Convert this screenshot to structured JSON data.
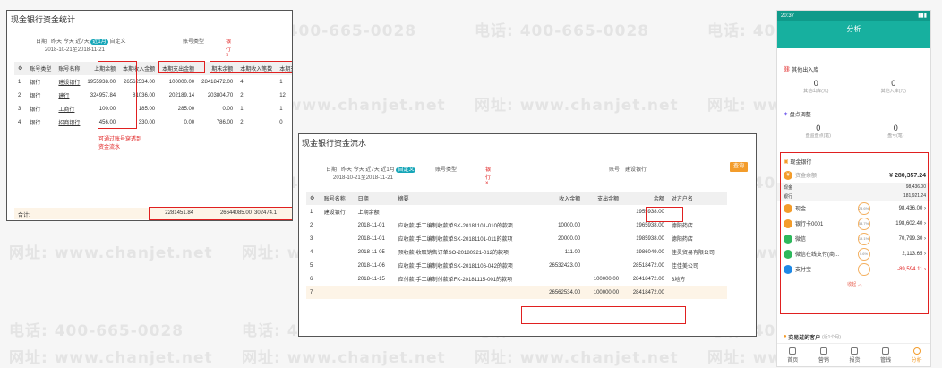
{
  "watermarks": [
    "电话: 400-665-0028",
    "网址: www.chanjet.net"
  ],
  "p1": {
    "title": "现金银行资金统计",
    "date_label": "日期",
    "ranges": [
      "昨天",
      "今天",
      "近7天"
    ],
    "active_range": "近1月",
    "custom": "自定义",
    "date_range": "2018-10-21至2018-11-21",
    "acct_type_label": "账号类型",
    "acct_tag": "银行",
    "acct_label": "账号",
    "headers": [
      "账号类型",
      "账号名称",
      "上期余额",
      "本期收入金额",
      "本期支出金额",
      "期末余额",
      "本期收入笔数",
      "本期支出笔数"
    ],
    "rows": [
      [
        "1",
        "银行",
        "建设银行",
        "1955938.00",
        "26562534.00",
        "100000.00",
        "28418472.00",
        "4",
        "1"
      ],
      [
        "2",
        "银行",
        "建行",
        "324957.84",
        "81036.00",
        "202189.14",
        "203804.70",
        "2",
        "12"
      ],
      [
        "3",
        "银行",
        "工商行",
        "100.00",
        "185.00",
        "285.00",
        "0.00",
        "1",
        "1"
      ],
      [
        "4",
        "银行",
        "招商银行",
        "456.00",
        "330.00",
        "0.00",
        "786.00",
        "2",
        "0"
      ]
    ],
    "note": "可通过账号穿透到资金流水",
    "total_label": "合计:",
    "totals": [
      "2281451.84",
      "26644085.00",
      "302474.1"
    ]
  },
  "p2": {
    "title": "现金银行资金流水",
    "date_label": "日期",
    "ranges": [
      "昨天",
      "今天",
      "近7天",
      "近1月"
    ],
    "active_range": "自定义",
    "date_range": "2018-10-21至2018-11-21",
    "acct_type_label": "账号类型",
    "acct_tag": "银行",
    "acct_label": "账号",
    "acct_value": "建设银行",
    "query": "查询",
    "headers": [
      "账号名称",
      "日期",
      "摘要",
      "收入金额",
      "支出金额",
      "余额",
      "对方户名"
    ],
    "rows": [
      [
        "1",
        "建设银行",
        "上期余额",
        "",
        "",
        "",
        "1955938.00",
        ""
      ],
      [
        "2",
        "",
        "2018-11-01",
        "应收款-手工编制收款单SK-20181101-010的款项",
        "10000.00",
        "",
        "1965938.00",
        "德阳药店"
      ],
      [
        "3",
        "",
        "2018-11-01",
        "应收款-手工编制收款单SK-20181101-011的款项",
        "20000.00",
        "",
        "1985938.00",
        "德阳药店"
      ],
      [
        "4",
        "",
        "2018-11-05",
        "预收款-收取销售订单SO-20180921-012的款项",
        "111.00",
        "",
        "1986049.00",
        "佳灵贸易有限公司"
      ],
      [
        "5",
        "",
        "2018-11-06",
        "应收款-手工编制收款单SK-20181106-042的款项",
        "26532423.00",
        "",
        "28518472.00",
        "佳佳美公司"
      ],
      [
        "6",
        "",
        "2018-11-15",
        "应付款-手工编制付款单FK-20181115-001的款项",
        "",
        "100000.00",
        "28418472.00",
        "3地方"
      ]
    ],
    "total": [
      "7",
      "",
      "",
      "",
      "26562534.00",
      "100000.00",
      "28418472.00",
      ""
    ]
  },
  "phone": {
    "time": "20:37",
    "nav_title": "分析",
    "sec1_title": "其他出入库",
    "sec1_vals": [
      "0",
      "0"
    ],
    "sec1_labels": [
      "其他出库(元)",
      "其他入库(元)"
    ],
    "sec2_title": "盘点调整",
    "sec2_vals": [
      "0",
      "0"
    ],
    "sec2_labels": [
      "盘盈盘点(笔)",
      "盘亏(笔)"
    ],
    "cash_title": "现金银行",
    "total_label": "资金余额",
    "total_val": "¥ 280,357.24",
    "sub1_label": "现金",
    "sub1_val": "98,436.00",
    "sub2_label": "银行",
    "sub2_val": "181,921.24",
    "items": [
      {
        "name": "现金",
        "pct": "28.6%",
        "val": "98,436.00",
        "color": "#f39c2b"
      },
      {
        "name": "银行卡0001",
        "pct": "53.7%",
        "val": "198,602.40",
        "color": "#f39c2b"
      },
      {
        "name": "微信",
        "pct": "19.1%",
        "val": "70,799.30",
        "color": "#2eb85c"
      },
      {
        "name": "微信在线支付(商...",
        "pct": "0.6%",
        "val": "2,113.65",
        "color": "#2eb85c"
      },
      {
        "name": "支付宝",
        "pct": "",
        "val": "-89,594.11",
        "color": "#1e88e5"
      }
    ],
    "collapse": "收起",
    "recent_title": "交易过的客户",
    "recent_sub": "(近1个月)",
    "tabs": [
      "首页",
      "营销",
      "报货",
      "管钱",
      "分析"
    ]
  }
}
